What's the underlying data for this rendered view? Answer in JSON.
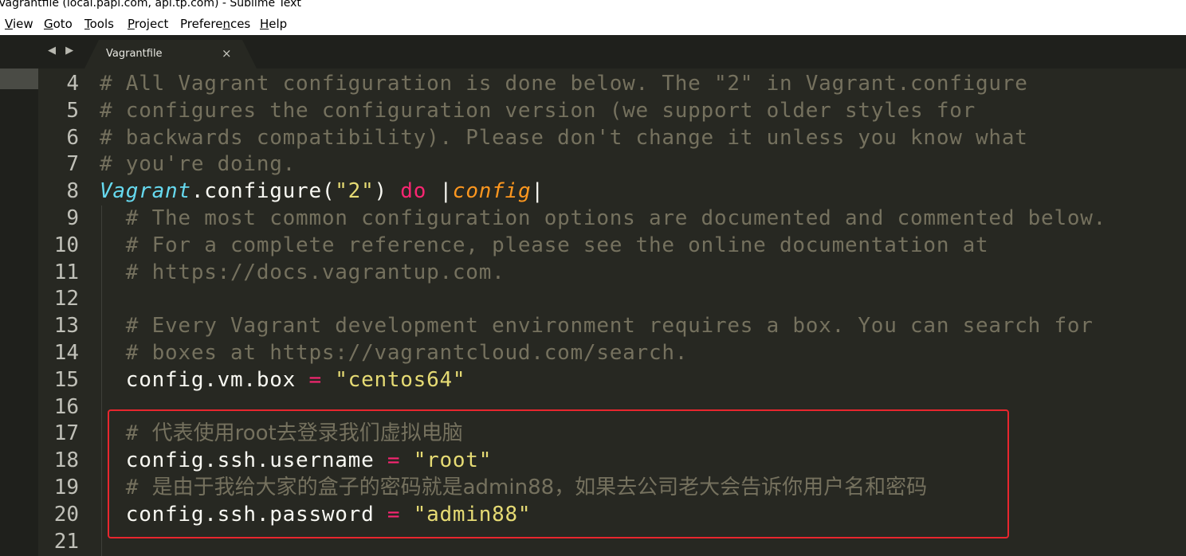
{
  "window": {
    "title": "Vagrantfile (local.papi.com, api.tp.com) - Sublime Text"
  },
  "menu": [
    {
      "pre": "",
      "acc": "V",
      "post": "iew"
    },
    {
      "pre": "",
      "acc": "G",
      "post": "oto"
    },
    {
      "pre": "",
      "acc": "T",
      "post": "ools"
    },
    {
      "pre": "",
      "acc": "P",
      "post": "roject"
    },
    {
      "pre": "Prefere",
      "acc": "n",
      "post": "ces"
    },
    {
      "pre": "",
      "acc": "H",
      "post": "elp"
    }
  ],
  "tabs": {
    "nav": "◀ ▶",
    "active": {
      "label": "Vagrantfile",
      "close": "×"
    }
  },
  "lines": [
    {
      "num": "4",
      "segs": [
        {
          "t": "# All Vagrant configuration is done below. The \"2\" in Vagrant.configure",
          "c": "comment"
        }
      ]
    },
    {
      "num": "5",
      "segs": [
        {
          "t": "# configures the configuration version (we support older styles for",
          "c": "comment"
        }
      ]
    },
    {
      "num": "6",
      "segs": [
        {
          "t": "# backwards compatibility). Please don't change it unless you know what",
          "c": "comment"
        }
      ]
    },
    {
      "num": "7",
      "segs": [
        {
          "t": "# you're doing.",
          "c": "comment"
        }
      ]
    },
    {
      "num": "8",
      "segs": [
        {
          "t": "Vagrant",
          "c": "class"
        },
        {
          "t": ".configure(",
          "c": "plain"
        },
        {
          "t": "\"2\"",
          "c": "string"
        },
        {
          "t": ") ",
          "c": "plain"
        },
        {
          "t": "do",
          "c": "keyword"
        },
        {
          "t": " |",
          "c": "plain"
        },
        {
          "t": "config",
          "c": "param"
        },
        {
          "t": "|",
          "c": "plain"
        }
      ]
    },
    {
      "num": "9",
      "segs": [
        {
          "t": "  # The most common configuration options are documented and commented below.",
          "c": "comment"
        }
      ]
    },
    {
      "num": "10",
      "segs": [
        {
          "t": "  # For a complete reference, please see the online documentation at",
          "c": "comment"
        }
      ]
    },
    {
      "num": "11",
      "segs": [
        {
          "t": "  # https://docs.vagrantup.com.",
          "c": "comment"
        }
      ]
    },
    {
      "num": "12",
      "segs": []
    },
    {
      "num": "13",
      "segs": [
        {
          "t": "  # Every Vagrant development environment requires a box. You can search for",
          "c": "comment"
        }
      ]
    },
    {
      "num": "14",
      "segs": [
        {
          "t": "  # boxes at https://vagrantcloud.com/search.",
          "c": "comment"
        }
      ]
    },
    {
      "num": "15",
      "segs": [
        {
          "t": "  config.vm.box ",
          "c": "plain"
        },
        {
          "t": "=",
          "c": "keyword"
        },
        {
          "t": " ",
          "c": "plain"
        },
        {
          "t": "\"centos64\"",
          "c": "string"
        }
      ]
    },
    {
      "num": "16",
      "segs": []
    },
    {
      "num": "17",
      "segs": [
        {
          "t": "  # ",
          "c": "comment"
        },
        {
          "t": "代表使用root去登录我们虚拟电脑",
          "c": "comment cjk"
        }
      ]
    },
    {
      "num": "18",
      "segs": [
        {
          "t": "  config.ssh.username ",
          "c": "plain"
        },
        {
          "t": "=",
          "c": "keyword"
        },
        {
          "t": " ",
          "c": "plain"
        },
        {
          "t": "\"root\"",
          "c": "string"
        }
      ]
    },
    {
      "num": "19",
      "segs": [
        {
          "t": "  # ",
          "c": "comment"
        },
        {
          "t": "是由于我给大家的盒子的密码就是admin88，如果去公司老大会告诉你用户名和密码",
          "c": "comment cjk"
        }
      ]
    },
    {
      "num": "20",
      "segs": [
        {
          "t": "  config.ssh.password ",
          "c": "plain"
        },
        {
          "t": "=",
          "c": "keyword"
        },
        {
          "t": " ",
          "c": "plain"
        },
        {
          "t": "\"admin88\"",
          "c": "string"
        }
      ]
    },
    {
      "num": "21",
      "segs": []
    }
  ],
  "colors": {
    "background": "#272822",
    "comment": "#75715e",
    "keyword": "#f92672",
    "string": "#e6db74",
    "class": "#66d9ef",
    "param": "#fd971f",
    "highlight_box": "#e8262e"
  }
}
